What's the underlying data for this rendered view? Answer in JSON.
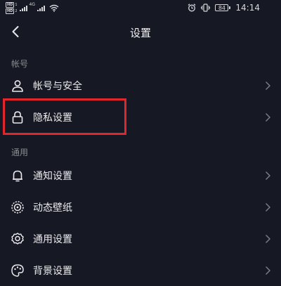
{
  "status_bar": {
    "hd1": "HD",
    "hd2": "HD",
    "sim1": "1",
    "sim2": "2",
    "network": "4G",
    "battery": "84",
    "time": "14:14"
  },
  "header": {
    "title": "设置",
    "back_icon": "chevron-left-icon"
  },
  "sections": [
    {
      "label": "帐号",
      "items": [
        {
          "label": "帐号与安全",
          "icon": "user-icon"
        },
        {
          "label": "隐私设置",
          "icon": "lock-icon",
          "highlighted": true
        }
      ]
    },
    {
      "label": "通用",
      "items": [
        {
          "label": "通知设置",
          "icon": "bell-icon"
        },
        {
          "label": "动态壁纸",
          "icon": "wallpaper-icon"
        },
        {
          "label": "通用设置",
          "icon": "gear-icon"
        },
        {
          "label": "背景设置",
          "icon": "palette-icon"
        }
      ]
    }
  ],
  "colors": {
    "background": "#161823",
    "text": "#eaeaec",
    "section_label": "#8a8b91",
    "highlight": "#e2262b"
  }
}
